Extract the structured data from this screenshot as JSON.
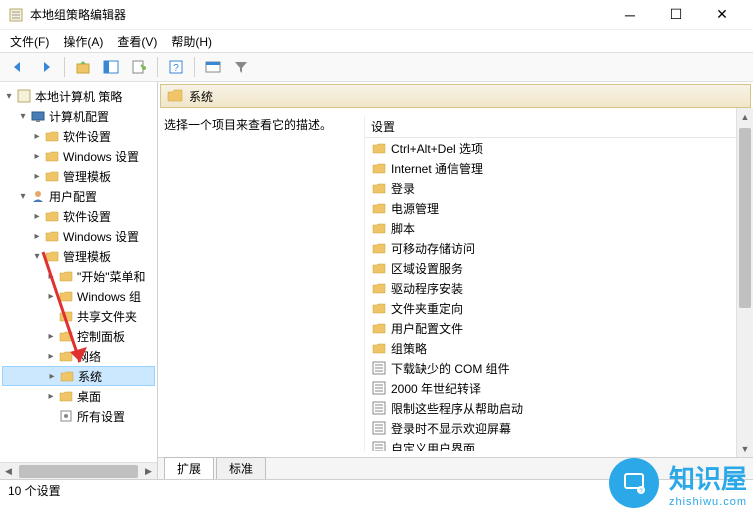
{
  "window": {
    "title": "本地组策略编辑器"
  },
  "menu": {
    "file": "文件(F)",
    "action": "操作(A)",
    "view": "查看(V)",
    "help": "帮助(H)"
  },
  "tree": {
    "root": "本地计算机 策略",
    "computer_config": "计算机配置",
    "software_settings1": "软件设置",
    "windows_settings1": "Windows 设置",
    "admin_templates1": "管理模板",
    "user_config": "用户配置",
    "software_settings2": "软件设置",
    "windows_settings2": "Windows 设置",
    "admin_templates2": "管理模板",
    "start_menu": "\"开始\"菜单和",
    "windows_components": "Windows 组",
    "shared_folders": "共享文件夹",
    "control_panel": "控制面板",
    "network": "网络",
    "system": "系统",
    "desktop": "桌面",
    "all_settings": "所有设置"
  },
  "content": {
    "header": "系统",
    "description": "选择一个项目来查看它的描述。",
    "list_header": "设置",
    "items": [
      {
        "icon": "folder",
        "label": "Ctrl+Alt+Del 选项"
      },
      {
        "icon": "folder",
        "label": "Internet 通信管理"
      },
      {
        "icon": "folder",
        "label": "登录"
      },
      {
        "icon": "folder",
        "label": "电源管理"
      },
      {
        "icon": "folder",
        "label": "脚本"
      },
      {
        "icon": "folder",
        "label": "可移动存储访问"
      },
      {
        "icon": "folder",
        "label": "区域设置服务"
      },
      {
        "icon": "folder",
        "label": "驱动程序安装"
      },
      {
        "icon": "folder",
        "label": "文件夹重定向"
      },
      {
        "icon": "folder",
        "label": "用户配置文件"
      },
      {
        "icon": "folder",
        "label": "组策略"
      },
      {
        "icon": "setting",
        "label": "下载缺少的 COM 组件"
      },
      {
        "icon": "setting",
        "label": "2000 年世纪转译"
      },
      {
        "icon": "setting",
        "label": "限制这些程序从帮助启动"
      },
      {
        "icon": "setting",
        "label": "登录时不显示欢迎屏幕"
      },
      {
        "icon": "setting",
        "label": "自定义用户界面"
      }
    ]
  },
  "tabs": {
    "extended": "扩展",
    "standard": "标准"
  },
  "status": {
    "text": "10 个设置"
  },
  "watermark": {
    "name": "知识屋",
    "url": "zhishiwu.com"
  }
}
